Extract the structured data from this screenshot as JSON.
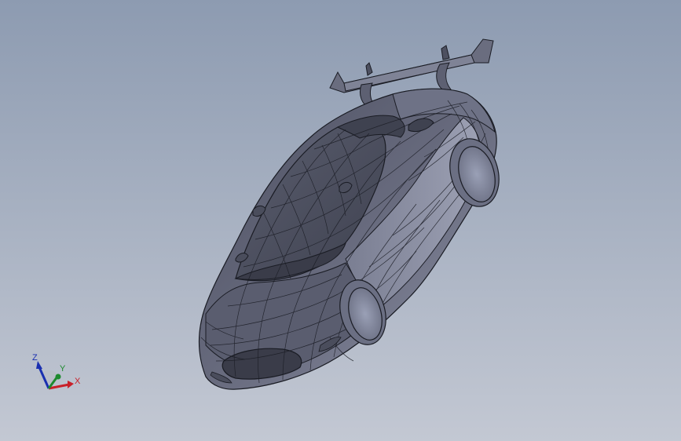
{
  "viewport": {
    "background_top": "#8d9bb1",
    "background_bottom": "#c3c8d3"
  },
  "model": {
    "body_color": "#5c5f70",
    "body_light_color": "#7a7e92",
    "edge_color": "#1a1c24",
    "wheel_color": "#8f93a8"
  },
  "triad": {
    "z_label": "Z",
    "y_label": "Y",
    "x_label": "X",
    "z_color": "#1a2fb0",
    "y_color": "#1e8a2e",
    "x_color": "#c8202a"
  }
}
